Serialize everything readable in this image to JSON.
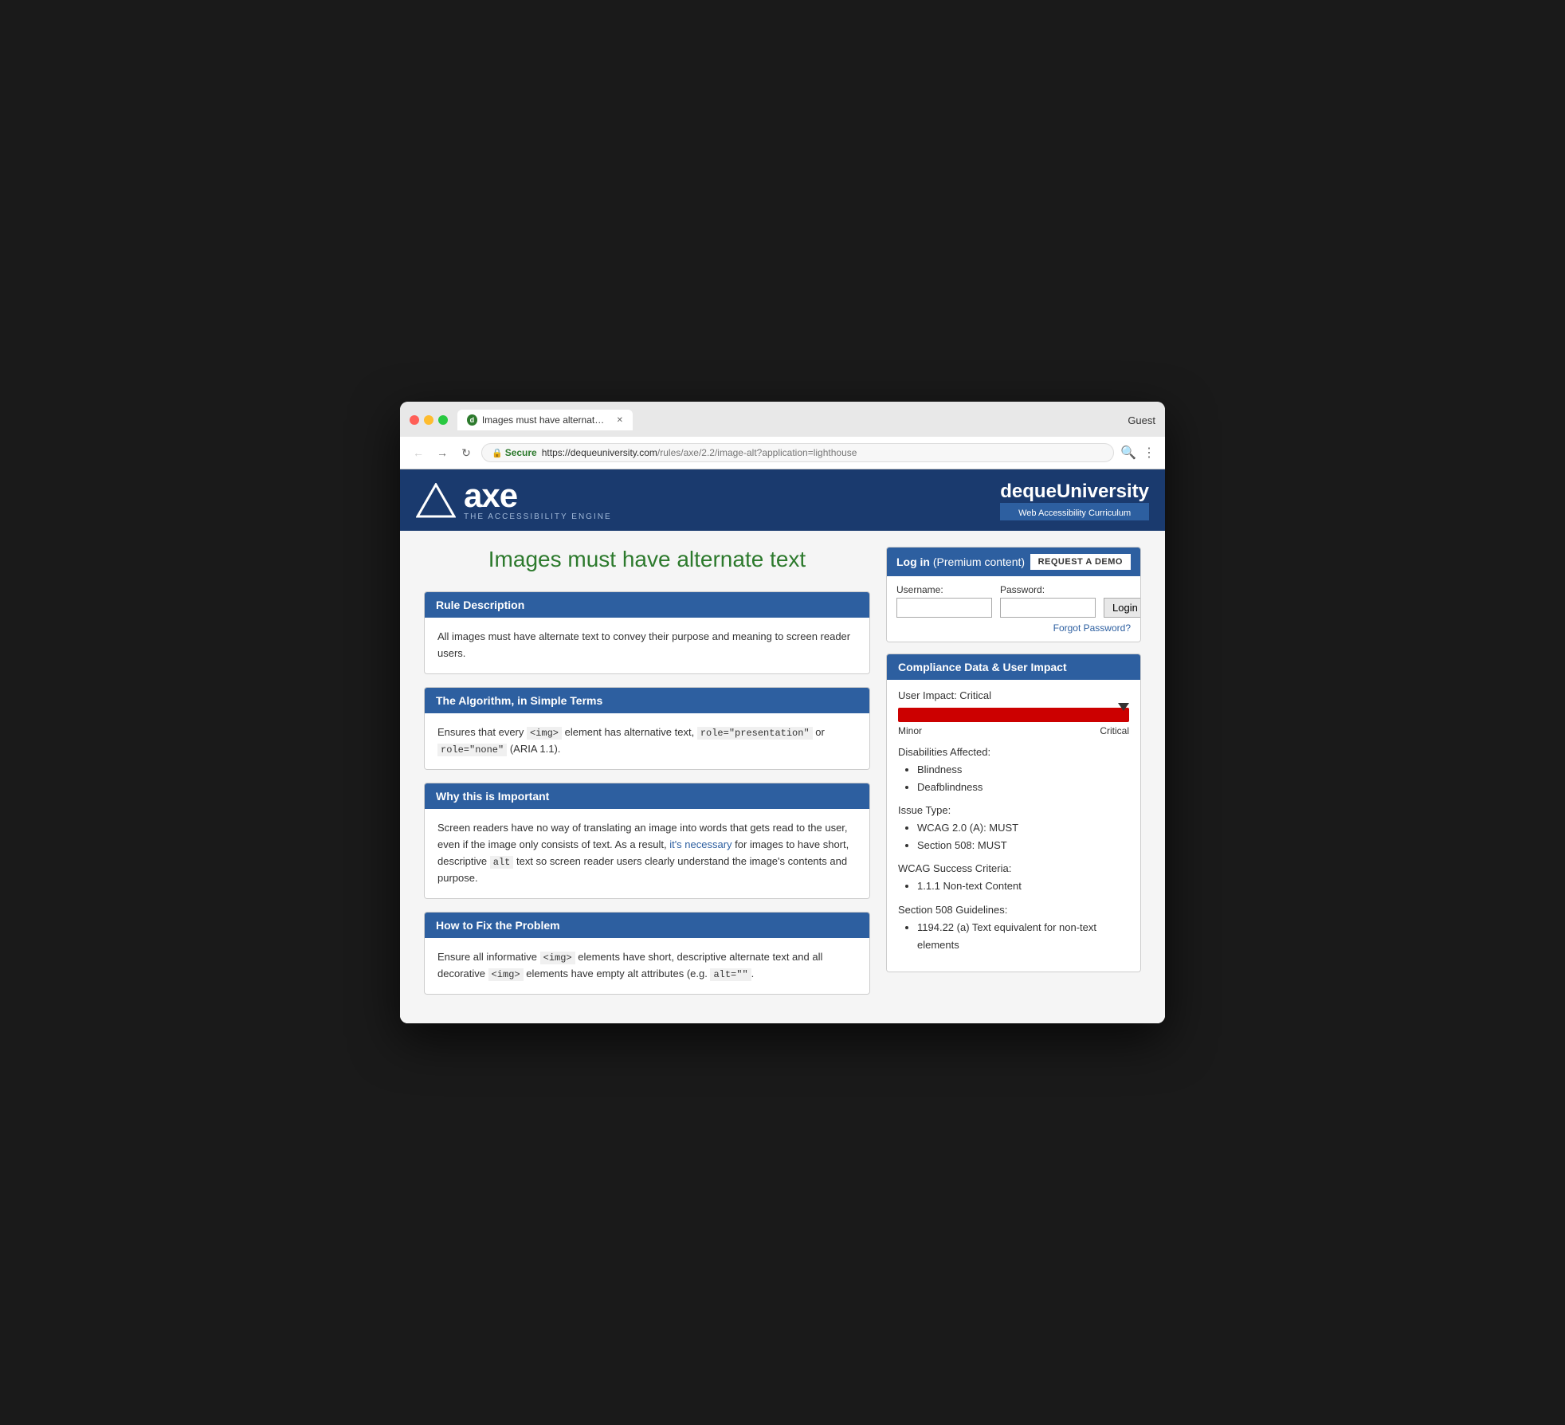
{
  "browser": {
    "tab_title": "Images must have alternate te…",
    "url_secure_label": "Secure",
    "url_full": "https://dequeuniversity.com/rules/axe/2.2/image-alt?application=lighthouse",
    "url_domain": "https://dequeuniversity.com",
    "url_path": "/rules/axe/2.2/image-alt?application=lighthouse",
    "guest_label": "Guest"
  },
  "header": {
    "axe_name": "axe",
    "axe_tagline": "THE ACCESSIBILITY ENGINE",
    "deque_name_prefix": "deque",
    "deque_name_suffix": "University",
    "deque_tagline": "Web Accessibility Curriculum"
  },
  "page": {
    "title": "Images must have alternate text"
  },
  "login": {
    "title_text": "Log in",
    "title_subtitle": "(Premium content)",
    "request_demo_label": "REQUEST A DEMO",
    "username_label": "Username:",
    "password_label": "Password:",
    "login_btn_label": "Login",
    "forgot_password_label": "Forgot Password?"
  },
  "compliance": {
    "section_title": "Compliance Data & User Impact",
    "user_impact_label": "User Impact: Critical",
    "impact_scale_min": "Minor",
    "impact_scale_max": "Critical",
    "disabilities_title": "Disabilities Affected:",
    "disabilities": [
      "Blindness",
      "Deafblindness"
    ],
    "issue_type_title": "Issue Type:",
    "issue_types": [
      "WCAG 2.0 (A): MUST",
      "Section 508: MUST"
    ],
    "wcag_title": "WCAG Success Criteria:",
    "wcag_items": [
      "1.1.1 Non-text Content"
    ],
    "section508_title": "Section 508 Guidelines:",
    "section508_items": [
      "1194.22 (a) Text equivalent for non-text elements"
    ]
  },
  "cards": [
    {
      "id": "rule-description",
      "header": "Rule Description",
      "body_html": "All images must have alternate text to convey their purpose and meaning to screen reader users."
    },
    {
      "id": "algorithm",
      "header": "The Algorithm, in Simple Terms",
      "body_html": "Ensures that every <code>&lt;img&gt;</code> element has alternative text, <code>role=\"presentation\"</code> or <code>role=\"none\"</code> (ARIA 1.1)."
    },
    {
      "id": "importance",
      "header": "Why this is Important",
      "body_html": "Screen readers have no way of translating an image into words that gets read to the user, even if the image only consists of text. As a result, it's necessary for images to have short, descriptive <code>alt</code> text so screen reader users clearly understand the image's contents and purpose."
    },
    {
      "id": "fix",
      "header": "How to Fix the Problem",
      "body_html": "Ensure all informative <code>&lt;img&gt;</code> elements have short, descriptive alternate text and all decorative <code>&lt;img&gt;</code> elements have empty alt attributes (e.g. <code>alt=\"\"</code>."
    }
  ]
}
